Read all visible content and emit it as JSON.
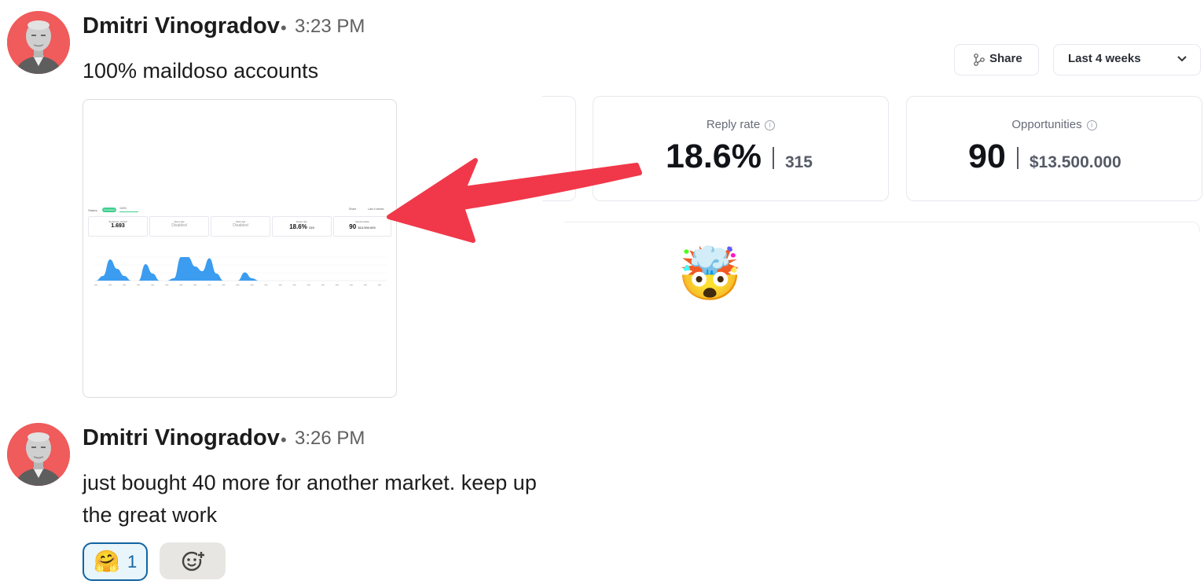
{
  "messages": [
    {
      "author": "Dmitri Vinogradov",
      "separator": "•",
      "time": "3:23 PM",
      "text": "100% maildoso accounts"
    },
    {
      "author": "Dmitri Vinogradov",
      "separator": "•",
      "time": "3:26 PM",
      "text_line1": "just bought 40 more for another market. keep up",
      "text_line2": "the great work"
    }
  ],
  "thumbnail": {
    "status_label": "Status:",
    "status_badge": "Completed",
    "progress": "100%",
    "share": "Share",
    "range": "Last 4 weeks",
    "cards": [
      {
        "label": "Sequence started",
        "value": "1.693"
      },
      {
        "label": "Open rate",
        "value": "Disabled"
      },
      {
        "label": "Click rate",
        "value": "Disabled"
      },
      {
        "label": "Reply rate",
        "value": "18.6%",
        "sub": "315"
      },
      {
        "label": "Opportunities",
        "value": "90",
        "sub": "$13.500.000"
      }
    ],
    "chart_data": {
      "type": "area",
      "series": [
        {
          "values": [
            0,
            0.2,
            0.9,
            0.5,
            0.2,
            0,
            0,
            0.7,
            0.3,
            0,
            0,
            0.1,
            1.0,
            1.0,
            0.6,
            0.4,
            0.95,
            0.3,
            0,
            0,
            0,
            0.35,
            0.1,
            0,
            0,
            0,
            0,
            0,
            0,
            0,
            0,
            0,
            0,
            0,
            0,
            0,
            0,
            0,
            0,
            0,
            0,
            0
          ]
        }
      ]
    }
  },
  "dashboard": {
    "share_label": "Share",
    "range_label": "Last 4 weeks",
    "reply_rate": {
      "label": "Reply rate",
      "value": "18.6%",
      "count": "315"
    },
    "opportunities": {
      "label": "Opportunities",
      "value": "90",
      "amount": "$13.500.000"
    },
    "emoji": "🤯"
  },
  "reactions": {
    "hug_emoji": "🤗",
    "hug_count": "1"
  },
  "colors": {
    "avatar_bg": "#f05b5b",
    "arrow": "#f0384a",
    "reaction_border": "#1264a3",
    "chart_fill": "#3b9cf0",
    "status_green": "#3fcf8e"
  }
}
